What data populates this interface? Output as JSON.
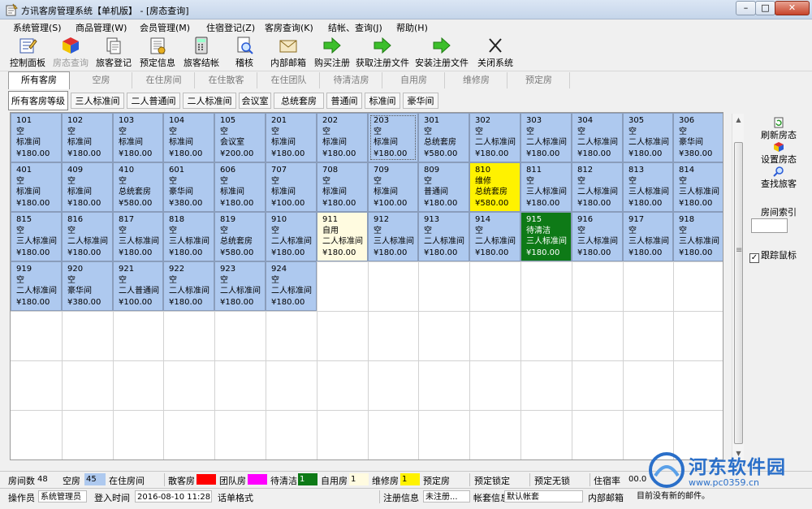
{
  "window": {
    "title": "方讯客房管理系统【单机版】 - [房态查询]",
    "min_label": "–",
    "max_label": "□",
    "close_label": "✕"
  },
  "menu": [
    "系统管理(S)",
    "商品管理(W)",
    "会员管理(M)",
    "住宿登记(Z)",
    "客房查询(K)",
    "结帐、查询(J)",
    "帮助(H)"
  ],
  "toolbar": [
    {
      "label": "控制面板",
      "icon": "control-panel-icon",
      "disabled": false
    },
    {
      "label": "房态查询",
      "icon": "room-status-icon",
      "disabled": true
    },
    {
      "label": "旅客登记",
      "icon": "guest-register-icon",
      "disabled": false
    },
    {
      "label": "预定信息",
      "icon": "reservation-icon",
      "disabled": false
    },
    {
      "label": "旅客结帐",
      "icon": "calculator-icon",
      "disabled": false
    },
    {
      "label": "稽核",
      "icon": "audit-icon",
      "disabled": false
    },
    {
      "label": "内部邮箱",
      "icon": "mail-icon",
      "disabled": false
    },
    {
      "label": "购买注册",
      "icon": "green-arrow-icon",
      "disabled": false
    },
    {
      "label": "获取注册文件",
      "icon": "green-arrow-icon",
      "disabled": false
    },
    {
      "label": "安装注册文件",
      "icon": "green-arrow-icon",
      "disabled": false
    },
    {
      "label": "关闭系统",
      "icon": "close-x-icon",
      "disabled": false
    }
  ],
  "status_tabs": [
    "所有客房",
    "空房",
    "在住房间",
    "在住散客",
    "在住团队",
    "待清洁房",
    "自用房",
    "维修房",
    "预定房"
  ],
  "status_tab_active": 0,
  "type_tabs": [
    "所有客房等级",
    "三人标准间",
    "二人普通间",
    "二人标准间",
    "会议室",
    "总统套房",
    "普通间",
    "标准间",
    "豪华间"
  ],
  "type_tab_active": 0,
  "rooms": [
    {
      "no": "101",
      "status": "空",
      "type": "标准间",
      "price": "¥180.00",
      "state": "vacant"
    },
    {
      "no": "102",
      "status": "空",
      "type": "标准间",
      "price": "¥180.00",
      "state": "vacant"
    },
    {
      "no": "103",
      "status": "空",
      "type": "标准间",
      "price": "¥180.00",
      "state": "vacant"
    },
    {
      "no": "104",
      "status": "空",
      "type": "标准间",
      "price": "¥180.00",
      "state": "vacant"
    },
    {
      "no": "105",
      "status": "空",
      "type": "会议室",
      "price": "¥200.00",
      "state": "vacant"
    },
    {
      "no": "201",
      "status": "空",
      "type": "标准间",
      "price": "¥180.00",
      "state": "vacant"
    },
    {
      "no": "202",
      "status": "空",
      "type": "标准间",
      "price": "¥180.00",
      "state": "vacant"
    },
    {
      "no": "203",
      "status": "空",
      "type": "标准间",
      "price": "¥180.00",
      "state": "vacant",
      "selected": true
    },
    {
      "no": "301",
      "status": "空",
      "type": "总统套房",
      "price": "¥580.00",
      "state": "vacant"
    },
    {
      "no": "302",
      "status": "空",
      "type": "二人标准间",
      "price": "¥180.00",
      "state": "vacant"
    },
    {
      "no": "303",
      "status": "空",
      "type": "二人标准间",
      "price": "¥180.00",
      "state": "vacant"
    },
    {
      "no": "304",
      "status": "空",
      "type": "二人标准间",
      "price": "¥180.00",
      "state": "vacant"
    },
    {
      "no": "305",
      "status": "空",
      "type": "二人标准间",
      "price": "¥180.00",
      "state": "vacant"
    },
    {
      "no": "306",
      "status": "空",
      "type": "豪华间",
      "price": "¥380.00",
      "state": "vacant"
    },
    {
      "no": "401",
      "status": "空",
      "type": "标准间",
      "price": "¥180.00",
      "state": "vacant"
    },
    {
      "no": "409",
      "status": "空",
      "type": "标准间",
      "price": "¥180.00",
      "state": "vacant"
    },
    {
      "no": "410",
      "status": "空",
      "type": "总统套房",
      "price": "¥580.00",
      "state": "vacant"
    },
    {
      "no": "601",
      "status": "空",
      "type": "豪华间",
      "price": "¥380.00",
      "state": "vacant"
    },
    {
      "no": "606",
      "status": "空",
      "type": "标准间",
      "price": "¥180.00",
      "state": "vacant"
    },
    {
      "no": "707",
      "status": "空",
      "type": "标准间",
      "price": "¥100.00",
      "state": "vacant"
    },
    {
      "no": "708",
      "status": "空",
      "type": "标准间",
      "price": "¥180.00",
      "state": "vacant"
    },
    {
      "no": "709",
      "status": "空",
      "type": "标准间",
      "price": "¥100.00",
      "state": "vacant"
    },
    {
      "no": "809",
      "status": "空",
      "type": "普通间",
      "price": "¥180.00",
      "state": "vacant"
    },
    {
      "no": "810",
      "status": "维修",
      "type": "总统套房",
      "price": "¥580.00",
      "state": "repair"
    },
    {
      "no": "811",
      "status": "空",
      "type": "三人标准间",
      "price": "¥180.00",
      "state": "vacant"
    },
    {
      "no": "812",
      "status": "空",
      "type": "二人标准间",
      "price": "¥180.00",
      "state": "vacant"
    },
    {
      "no": "813",
      "status": "空",
      "type": "三人标准间",
      "price": "¥180.00",
      "state": "vacant"
    },
    {
      "no": "814",
      "status": "空",
      "type": "三人标准间",
      "price": "¥180.00",
      "state": "vacant"
    },
    {
      "no": "815",
      "status": "空",
      "type": "三人标准间",
      "price": "¥180.00",
      "state": "vacant"
    },
    {
      "no": "816",
      "status": "空",
      "type": "二人标准间",
      "price": "¥180.00",
      "state": "vacant"
    },
    {
      "no": "817",
      "status": "空",
      "type": "三人标准间",
      "price": "¥180.00",
      "state": "vacant"
    },
    {
      "no": "818",
      "status": "空",
      "type": "三人标准间",
      "price": "¥180.00",
      "state": "vacant"
    },
    {
      "no": "819",
      "status": "空",
      "type": "总统套房",
      "price": "¥580.00",
      "state": "vacant"
    },
    {
      "no": "910",
      "status": "空",
      "type": "二人标准间",
      "price": "¥180.00",
      "state": "vacant"
    },
    {
      "no": "911",
      "status": "自用",
      "type": "二人标准间",
      "price": "¥180.00",
      "state": "selfuse"
    },
    {
      "no": "912",
      "status": "空",
      "type": "三人标准间",
      "price": "¥180.00",
      "state": "vacant"
    },
    {
      "no": "913",
      "status": "空",
      "type": "二人标准间",
      "price": "¥180.00",
      "state": "vacant"
    },
    {
      "no": "914",
      "status": "空",
      "type": "二人标准间",
      "price": "¥180.00",
      "state": "vacant"
    },
    {
      "no": "915",
      "status": "待清洁",
      "type": "三人标准间",
      "price": "¥180.00",
      "state": "clean"
    },
    {
      "no": "916",
      "status": "空",
      "type": "三人标准间",
      "price": "¥180.00",
      "state": "vacant"
    },
    {
      "no": "917",
      "status": "空",
      "type": "三人标准间",
      "price": "¥180.00",
      "state": "vacant"
    },
    {
      "no": "918",
      "status": "空",
      "type": "三人标准间",
      "price": "¥180.00",
      "state": "vacant"
    },
    {
      "no": "919",
      "status": "空",
      "type": "二人标准间",
      "price": "¥180.00",
      "state": "vacant"
    },
    {
      "no": "920",
      "status": "空",
      "type": "豪华间",
      "price": "¥380.00",
      "state": "vacant"
    },
    {
      "no": "921",
      "status": "空",
      "type": "二人普通间",
      "price": "¥100.00",
      "state": "vacant"
    },
    {
      "no": "922",
      "status": "空",
      "type": "二人标准间",
      "price": "¥180.00",
      "state": "vacant"
    },
    {
      "no": "923",
      "status": "空",
      "type": "二人标准间",
      "price": "¥180.00",
      "state": "vacant"
    },
    {
      "no": "924",
      "status": "空",
      "type": "二人标准间",
      "price": "¥180.00",
      "state": "vacant"
    }
  ],
  "right_panel": {
    "refresh_label": "刷新房态",
    "settings_label": "设置房态",
    "find_label": "查找旅客",
    "index_label": "房间索引",
    "index_value": "",
    "track_mouse_label": "跟踪鼠标",
    "track_mouse_checked": true
  },
  "status1": {
    "room_count_label": "房间数",
    "room_count": "48",
    "vacant_label": "空房",
    "vacant_count": "45",
    "occupied_label": "在住房间",
    "occupied_count": "",
    "walkin_label": "散客房",
    "walkin_color": "#ff0000",
    "group_label": "团队房",
    "group_color": "#ff00ff",
    "cleaning_label": "待清洁",
    "cleaning_count": "1",
    "cleaning_color": "#0e7a17",
    "selfuse_label": "自用房",
    "selfuse_count": "1",
    "selfuse_color": "#fffbe0",
    "repair_label": "维修房",
    "repair_count": "1",
    "repair_color": "#fff200",
    "reserved_label": "预定房",
    "reserved_locked_label": "预定锁定",
    "reserved_none_label": "预定无锁",
    "occupancy_label": "住宿率",
    "occupancy_value": "00.0"
  },
  "status2": {
    "operator_label": "操作员",
    "operator_value": "系统管理员",
    "login_label": "登入时间",
    "login_value": "2016-08-10 11:28:57",
    "format_label": "话单格式",
    "format_value": "",
    "reg_label": "注册信息",
    "reg_value": "未注册...",
    "account_label": "帐套信息",
    "account_value": "默认帐套",
    "mail_label": "内部邮箱",
    "mail_value": "目前没有新的邮件。"
  },
  "watermark": {
    "text1": "河东软件园",
    "text2": "www.pc0359.cn"
  }
}
